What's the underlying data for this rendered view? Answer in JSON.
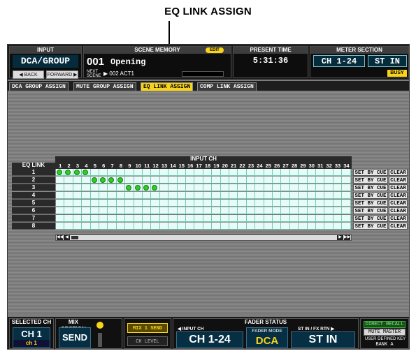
{
  "callout": {
    "title": "EQ LINK ASSIGN"
  },
  "header": {
    "input_caption": "INPUT",
    "mode": "DCA/GROUP",
    "back_label": "◀ BACK",
    "forward_label": "FORWARD ▶",
    "scene_caption": "SCENE MEMORY",
    "edit_badge": "EDIT",
    "scene_number": "001",
    "scene_name": "Opening",
    "next_label": "NEXT SCENE",
    "next_scene": "▶ 002 ACT1",
    "time_caption": "PRESENT TIME",
    "time_value": "5:31:36",
    "meter_caption": "METER SECTION",
    "meter_ch": "CH 1-24",
    "meter_st": "ST IN",
    "busy": "BUSY"
  },
  "tabs": [
    "DCA GROUP ASSIGN",
    "MUTE GROUP ASSIGN",
    "EQ LINK ASSIGN",
    "COMP LINK ASSIGN"
  ],
  "active_tab": 2,
  "grid": {
    "row_header": "EQ LINK",
    "col_header": "INPUT CH",
    "channels": [
      "1",
      "2",
      "3",
      "4",
      "5",
      "6",
      "7",
      "8",
      "9",
      "10",
      "11",
      "12",
      "13",
      "14",
      "15",
      "16",
      "17",
      "18",
      "19",
      "20",
      "21",
      "22",
      "23",
      "24",
      "25",
      "26",
      "27",
      "28",
      "29",
      "30",
      "31",
      "32",
      "33",
      "34"
    ],
    "rows": [
      {
        "label": "1",
        "assigned": [
          1,
          2,
          3,
          4
        ]
      },
      {
        "label": "2",
        "assigned": [
          5,
          6,
          7,
          8
        ]
      },
      {
        "label": "3",
        "assigned": [
          9,
          10,
          11,
          12
        ]
      },
      {
        "label": "4",
        "assigned": []
      },
      {
        "label": "5",
        "assigned": []
      },
      {
        "label": "6",
        "assigned": []
      },
      {
        "label": "7",
        "assigned": []
      },
      {
        "label": "8",
        "assigned": []
      }
    ],
    "set_by_cue_label": "SET BY CUE",
    "clear_label": "CLEAR",
    "scroll_left_fast": "◀◀",
    "scroll_left": "◀",
    "scroll_right": "▶",
    "scroll_right_fast": "▶▶"
  },
  "footer": {
    "selected_caption": "SELECTED CH",
    "selected_ch": "CH 1",
    "selected_sub": "ch 1",
    "mix_caption": "MIX SECTION",
    "mix_value": "SEND",
    "mix_send": "MIX 1 SEND",
    "ch_level": "CH LEVEL",
    "fader_caption": "FADER STATUS",
    "input_ch_caption": "◀ INPUT CH",
    "input_ch_value": "CH 1-24",
    "fader_mode_caption": "FADER MODE",
    "fader_mode_value": "DCA",
    "st_caption": "ST IN / FX RTN ▶",
    "st_value": "ST IN",
    "direct_recall": "DIRECT RECALL",
    "mute_master": "MUTE MASTER",
    "user_key_caption": "USER DEFINED KEY",
    "bank": "BANK A"
  },
  "colors": {
    "accent": "#f8d31b",
    "lcd_bg": "#052c3d",
    "dot": "#33cc22",
    "cell": "#e8fbfb"
  }
}
